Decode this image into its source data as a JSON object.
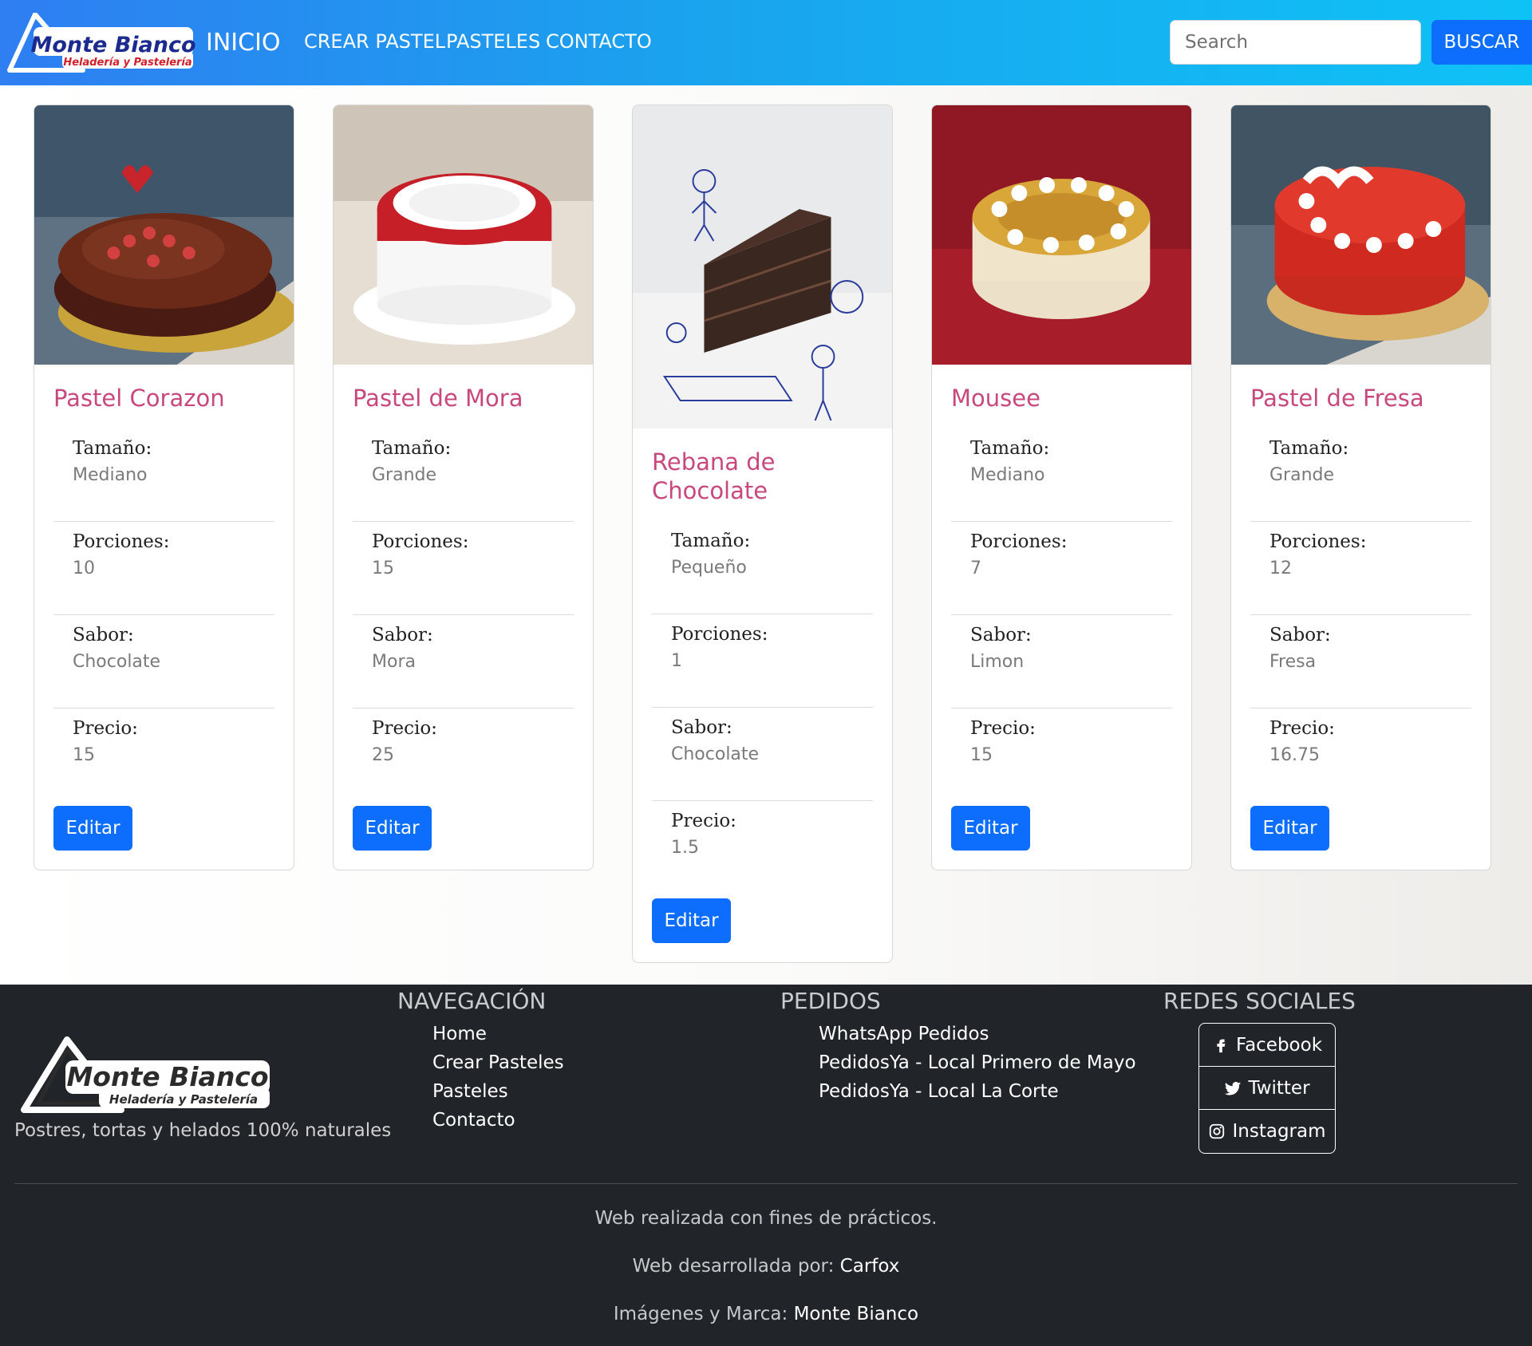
{
  "navbar": {
    "brand_name": "Monte Bianco",
    "brand_sub": "Heladería y Pastelería",
    "home": "INICIO",
    "links": [
      "CREAR PASTEL",
      "PASTELES",
      "CONTACTO"
    ],
    "search_placeholder": "Search",
    "search_button": "BUSCAR"
  },
  "cards": [
    {
      "title": "Pastel Corazon",
      "size_label": "Tamaño:",
      "size": "Mediano",
      "portions_label": "Porciones:",
      "portions": "10",
      "flavor_label": "Sabor:",
      "flavor": "Chocolate",
      "price_label": "Precio:",
      "price": "15",
      "button": "Editar"
    },
    {
      "title": "Pastel de Mora",
      "size_label": "Tamaño:",
      "size": "Grande",
      "portions_label": "Porciones:",
      "portions": "15",
      "flavor_label": "Sabor:",
      "flavor": "Mora",
      "price_label": "Precio:",
      "price": "25",
      "button": "Editar"
    },
    {
      "title": "Rebana de Chocolate",
      "size_label": "Tamaño:",
      "size": "Pequeño",
      "portions_label": "Porciones:",
      "portions": "1",
      "flavor_label": "Sabor:",
      "flavor": "Chocolate",
      "price_label": "Precio:",
      "price": "1.5",
      "button": "Editar"
    },
    {
      "title": "Mousee",
      "size_label": "Tamaño:",
      "size": "Mediano",
      "portions_label": "Porciones:",
      "portions": "7",
      "flavor_label": "Sabor:",
      "flavor": "Limon",
      "price_label": "Precio:",
      "price": "15",
      "button": "Editar"
    },
    {
      "title": "Pastel de Fresa",
      "size_label": "Tamaño:",
      "size": "Grande",
      "portions_label": "Porciones:",
      "portions": "12",
      "flavor_label": "Sabor:",
      "flavor": "Fresa",
      "price_label": "Precio:",
      "price": "16.75",
      "button": "Editar"
    }
  ],
  "footer": {
    "tagline": "Postres, tortas y helados 100% naturales",
    "nav_heading": "NAVEGACIÓN",
    "nav_links": [
      "Home",
      "Crear Pasteles",
      "Pasteles",
      "Contacto"
    ],
    "orders_heading": "PEDIDOS",
    "orders_links": [
      "WhatsApp Pedidos",
      "PedidosYa - Local Primero de Mayo",
      "PedidosYa - Local La Corte"
    ],
    "social_heading": "REDES SOCIALES",
    "social": [
      "Facebook",
      "Twitter",
      "Instagram"
    ],
    "note": "Web realizada con fines de prácticos.",
    "dev_label": "Web desarrollada por:",
    "dev_name": "Carfox",
    "img_label": "Imágenes y Marca:",
    "img_name": "Monte Bianco"
  },
  "colors": {
    "accent": "#0d6efd",
    "card_title": "#c8487e",
    "footer_bg": "#212529"
  }
}
